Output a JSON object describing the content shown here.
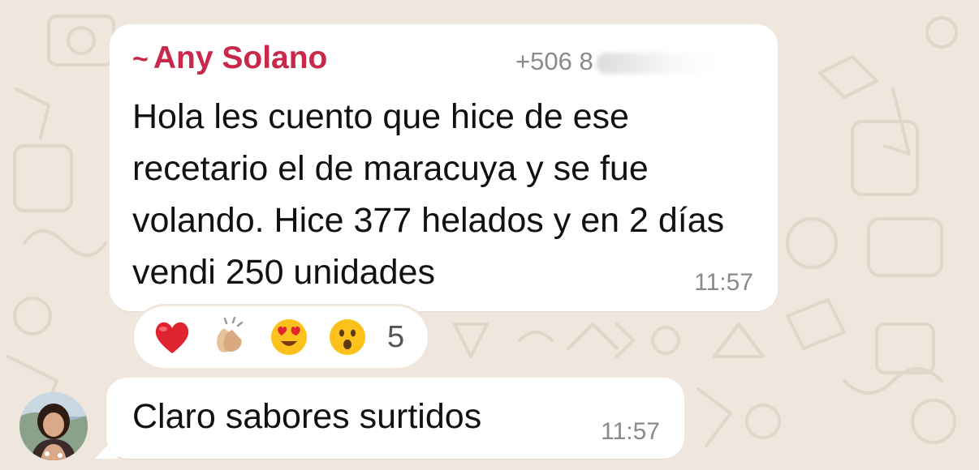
{
  "theme": {
    "wallpaper_color": "#efe7dd",
    "doodle_color": "#e3d8cb",
    "bubble_color": "#ffffff",
    "sender_color": "#c8284a",
    "time_color": "#8a8a8a"
  },
  "messages": [
    {
      "sender_prefix": "~",
      "sender_name": "Any Solano",
      "sender_phone": "+506 8",
      "text": "Hola les cuento que hice de ese recetario el de maracuya y se fue volando. Hice 377 helados y en 2 días vendi 250 unidades",
      "time": "11:57",
      "reactions": {
        "emojis": [
          "heart-emoji",
          "clapping-hands-emoji",
          "heart-eyes-emoji",
          "surprised-face-emoji"
        ],
        "count": "5"
      }
    },
    {
      "text": "Claro sabores surtidos",
      "time": "11:57"
    }
  ]
}
